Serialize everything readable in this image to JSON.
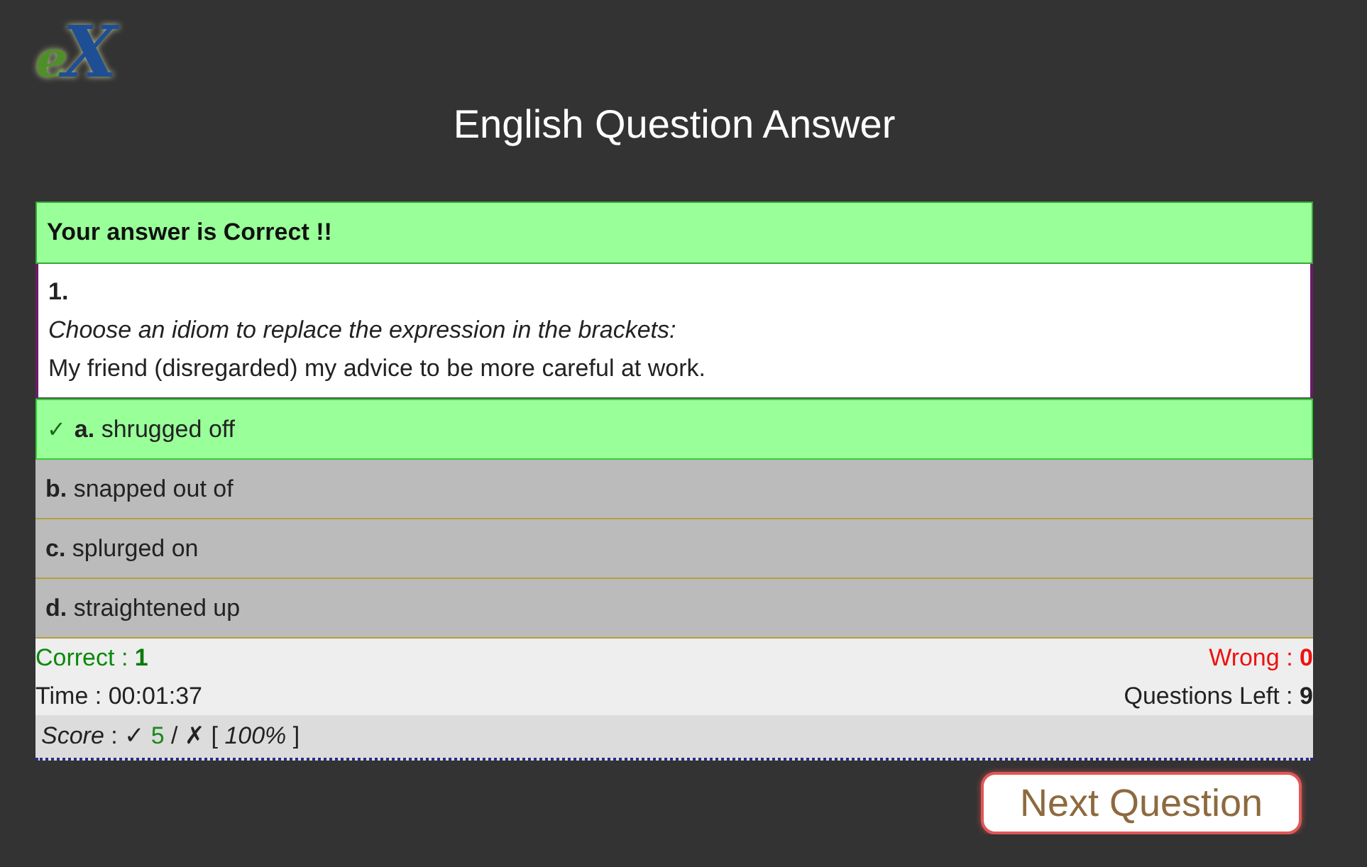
{
  "logo": "eX",
  "title": "English Question Answer",
  "result": {
    "text": "Your answer is Correct !!",
    "correct": true
  },
  "question": {
    "number": "1.",
    "instruction": "Choose an idiom to replace the expression in the brackets:",
    "text": "My friend (disregarded) my advice to be more careful at work."
  },
  "options": [
    {
      "mark": "✓",
      "letter": "a.",
      "text": "shrugged off",
      "selected": true
    },
    {
      "letter": "b.",
      "text": "snapped out of",
      "selected": false
    },
    {
      "letter": "c.",
      "text": "splurged on",
      "selected": false
    },
    {
      "letter": "d.",
      "text": "straightened up",
      "selected": false
    }
  ],
  "stats": [
    {
      "kind": "correct",
      "label": "Correct :",
      "value": "1"
    },
    {
      "kind": "wrong",
      "label": "Wrong :",
      "value": "0"
    },
    {
      "kind": "time",
      "label": "Time :",
      "value": "00:01:37"
    },
    {
      "kind": "left",
      "label": "Questions Left :",
      "value": "9"
    }
  ],
  "score": [
    {
      "kind": "label",
      "text": "Score"
    },
    {
      "kind": "plain",
      "text": ": ✓"
    },
    {
      "kind": "count",
      "text": "5"
    },
    {
      "kind": "plain",
      "text": "/ ✗ ["
    },
    {
      "kind": "percent",
      "text": "100%"
    },
    {
      "kind": "plain",
      "text": "]"
    }
  ],
  "next_button": "Next Question"
}
